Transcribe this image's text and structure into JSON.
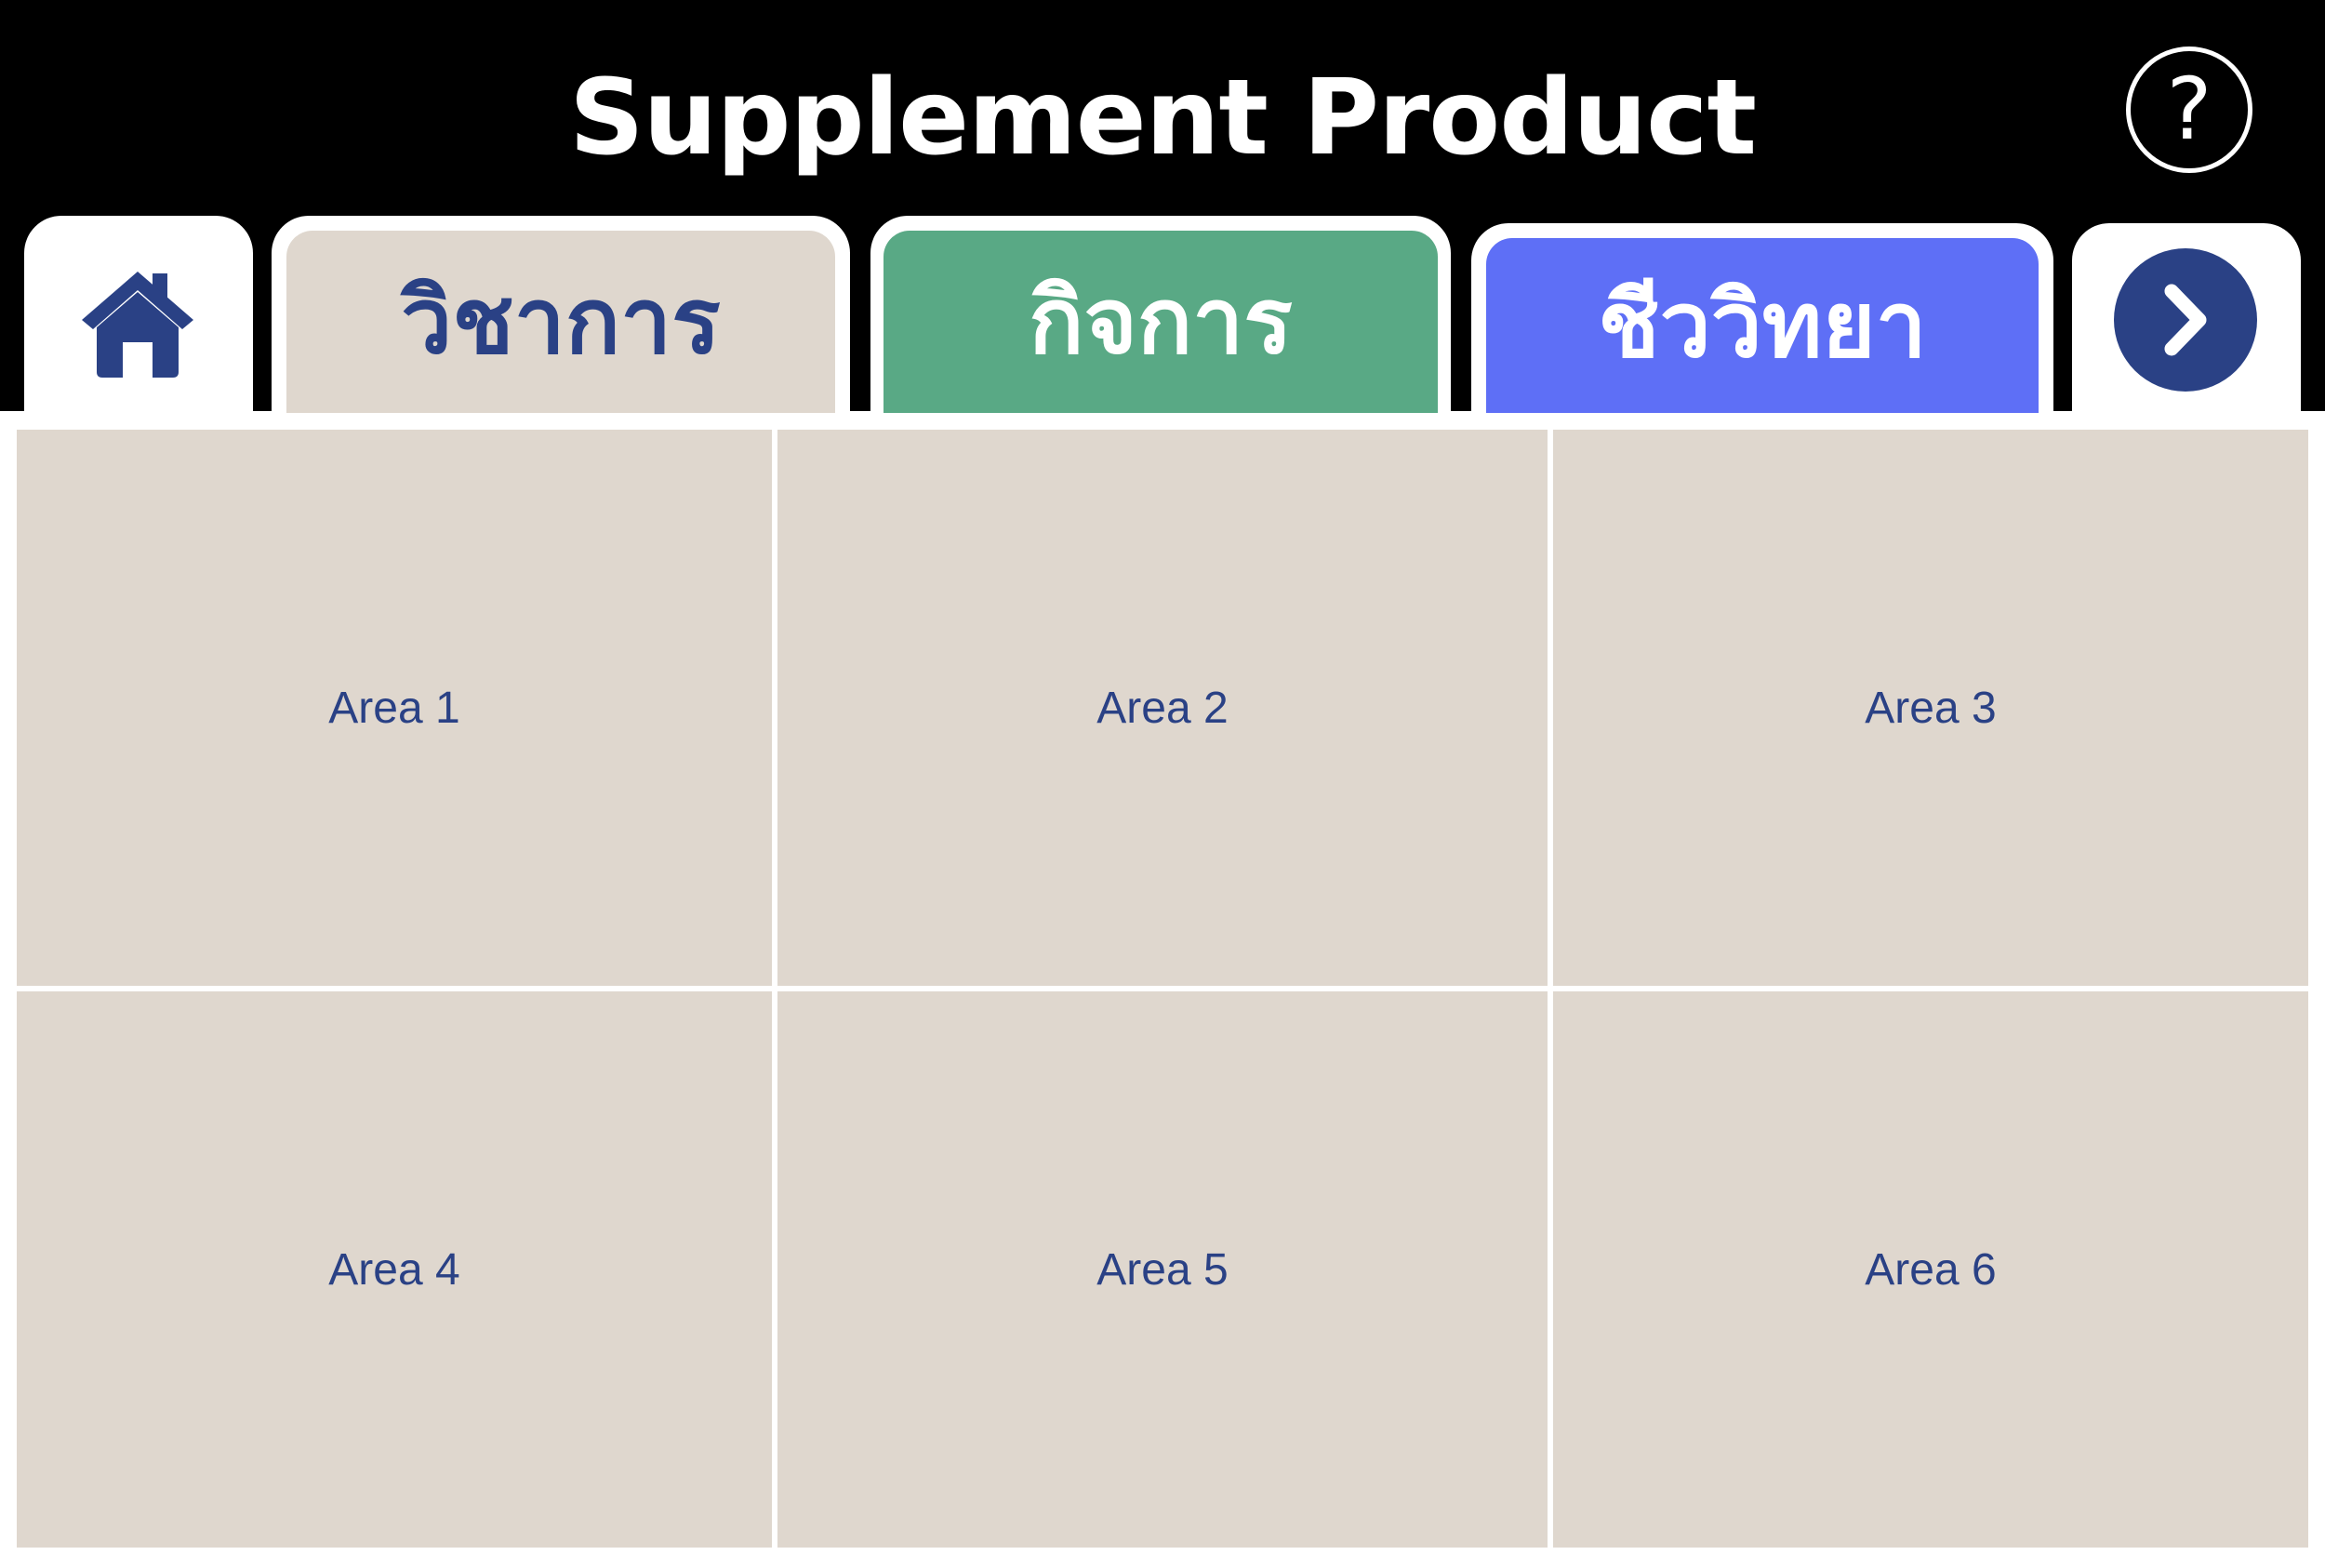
{
  "header": {
    "title": "Supplement Product",
    "help_label": "?"
  },
  "tabs": [
    {
      "label": "วิชาการ",
      "color": "#dfd7ce",
      "text_color": "#2a4185"
    },
    {
      "label": "กิจการ",
      "color": "#59a985",
      "text_color": "#ffffff"
    },
    {
      "label": "ชีววิทยา",
      "color": "#5e6ff6",
      "text_color": "#ffffff"
    }
  ],
  "icons": {
    "home": "home-icon",
    "next": "chevron-right-icon",
    "help": "question-icon"
  },
  "areas": [
    {
      "label": "Area 1"
    },
    {
      "label": "Area 2"
    },
    {
      "label": "Area 3"
    },
    {
      "label": "Area 4"
    },
    {
      "label": "Area 5"
    },
    {
      "label": "Area 6"
    }
  ],
  "colors": {
    "header_bg": "#000000",
    "accent_navy": "#2a4185",
    "area_bg": "#dfd7ce"
  }
}
